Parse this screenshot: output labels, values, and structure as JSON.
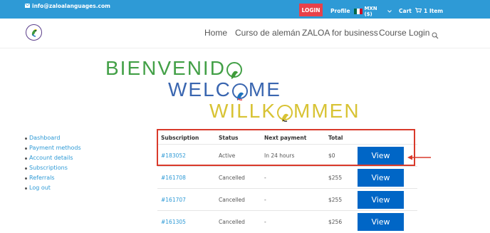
{
  "topbar": {
    "email": "info@zaloalanguages.com",
    "login": "LOGIN",
    "profile": "Profile",
    "currency": "MXN ($)",
    "cart": "Cart",
    "cart_count": "1 Item"
  },
  "nav": {
    "items": [
      "Home",
      "Curso de alemán",
      "ZALOA for business",
      "Course Login"
    ]
  },
  "banner": {
    "line1a": "BIENVENID",
    "line1b": "",
    "line2a": "WELC",
    "line2b": "ME",
    "line3a": "WILLK",
    "line3b": "MMEN"
  },
  "sidebar": {
    "items": [
      "Dashboard",
      "Payment methods",
      "Account details",
      "Subscriptions",
      "Referrals",
      "Log out"
    ]
  },
  "table": {
    "headers": [
      "Subscription",
      "Status",
      "Next payment",
      "Total"
    ],
    "rows": [
      {
        "id": "#183052",
        "status": "Active",
        "next": "In 24 hours",
        "total": "$0",
        "action": "View"
      },
      {
        "id": "#161708",
        "status": "Cancelled",
        "next": "-",
        "total": "$255",
        "action": "View"
      },
      {
        "id": "#161707",
        "status": "Cancelled",
        "next": "-",
        "total": "$255",
        "action": "View"
      },
      {
        "id": "#161305",
        "status": "Cancelled",
        "next": "-",
        "total": "$256",
        "action": "View"
      }
    ]
  },
  "colors": {
    "topbar": "#2e9ad6",
    "login": "#e8414a",
    "button": "#0066c6",
    "highlight": "#d93a2b"
  }
}
